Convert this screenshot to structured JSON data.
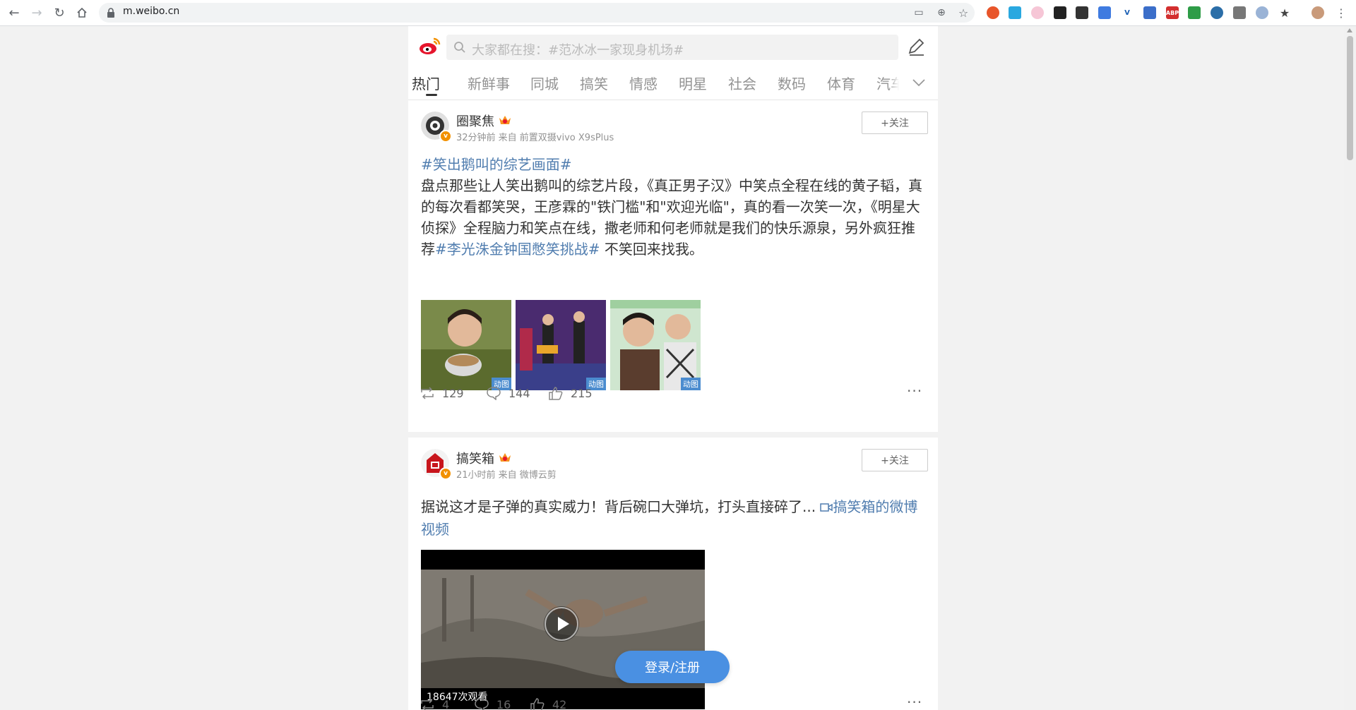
{
  "browser": {
    "url": "m.weibo.cn"
  },
  "header": {
    "search_placeholder": "大家都在搜：#范冰冰一家现身机场#",
    "tabs": [
      {
        "label": "热门"
      },
      {
        "label": "新鲜事"
      },
      {
        "label": "同城"
      },
      {
        "label": "搞笑"
      },
      {
        "label": "情感"
      },
      {
        "label": "明星"
      },
      {
        "label": "社会"
      },
      {
        "label": "数码"
      },
      {
        "label": "体育"
      },
      {
        "label": "汽车"
      }
    ]
  },
  "posts": [
    {
      "username": "圈聚焦",
      "meta": "32分钟前 来自 前置双摄vivo X9sPlus",
      "follow_label": "+关注",
      "topic_title": "#笑出鹅叫的综艺画面#",
      "text_main": "盘点那些让人笑出鹅叫的综艺片段，《真正男子汉》中笑点全程在线的黄子韬，真的每次看都笑哭，王彦霖的\"铁门槛\"和\"欢迎光临\"，真的看一次笑一次，《明星大侦探》全程脑力和笑点在线，撒老师和何老师就是我们的快乐源泉，另外疯狂推荐",
      "inline_topic": "#李光洙金钟国憋笑挑战#",
      "text_tail": " 不笑回来找我。",
      "images": [
        {
          "badge": "动图"
        },
        {
          "badge": "动图"
        },
        {
          "badge": "动图"
        }
      ],
      "reposts": "129",
      "comments": "144",
      "likes": "215"
    },
    {
      "username": "搞笑箱",
      "meta": "21小时前 来自 微博云剪",
      "follow_label": "+关注",
      "text_main": "据说这才是子弹的真实威力！背后碗口大弹坑，打头直接碎了...",
      "video_link": "搞笑箱的微博视频",
      "video_views": "18647次观看",
      "reposts": "4",
      "comments": "16",
      "likes": "42"
    }
  ],
  "login_button": "登录/注册",
  "colors": {
    "link": "#507daf",
    "login": "#4a90e2",
    "vip": "#f29100"
  }
}
